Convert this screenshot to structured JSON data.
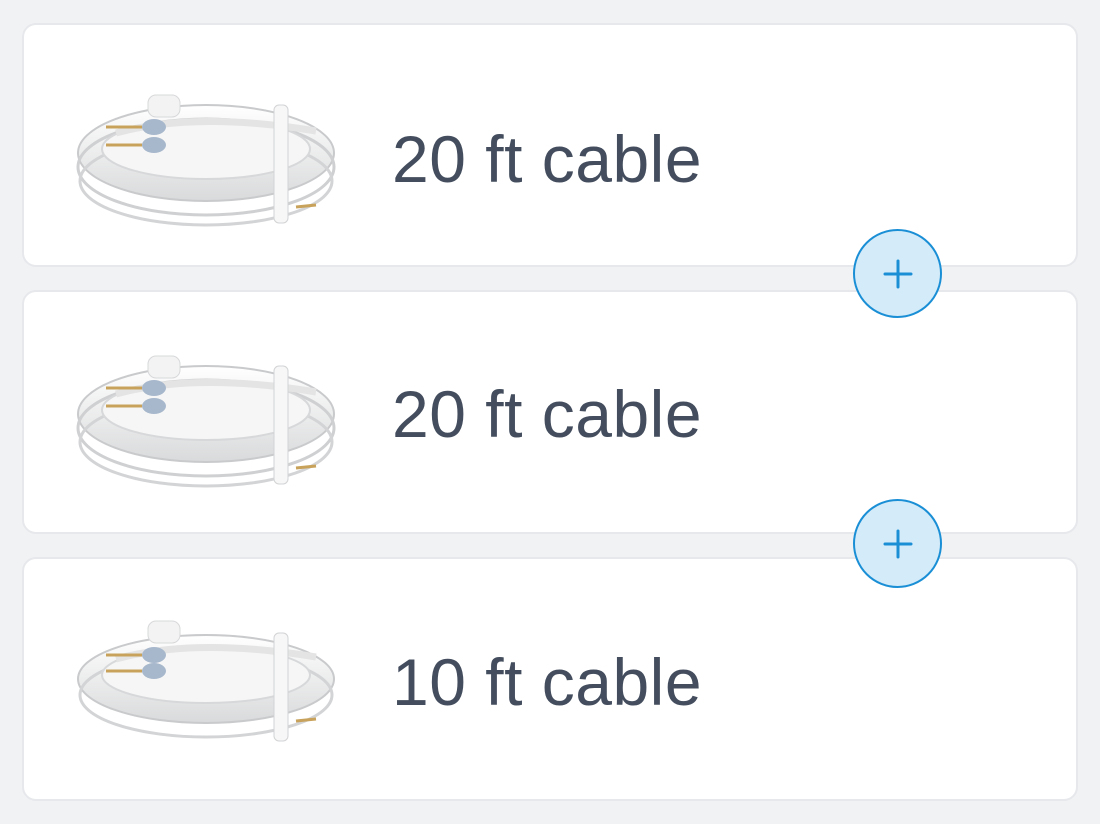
{
  "items": [
    {
      "label": "20 ft cable",
      "image_icon": "cable-coil-icon"
    },
    {
      "label": "20 ft cable",
      "image_icon": "cable-coil-icon"
    },
    {
      "label": "10 ft cable",
      "image_icon": "cable-coil-icon"
    }
  ],
  "add_buttons": [
    {
      "icon": "plus-icon"
    },
    {
      "icon": "plus-icon"
    }
  ],
  "colors": {
    "background": "#f1f2f4",
    "card": "#ffffff",
    "label_text": "#434d5d",
    "accent": "#1a8fd6",
    "accent_fill": "#d4ebf9"
  }
}
